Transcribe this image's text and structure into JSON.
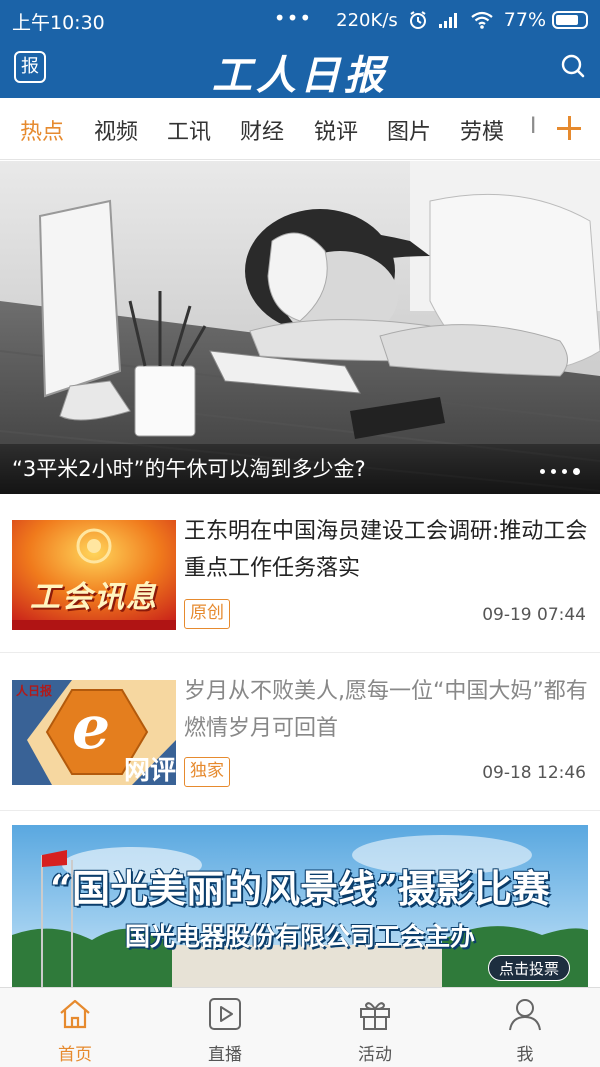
{
  "status_bar": {
    "time": "上午10:30",
    "dots": "•••",
    "speed": "220K/s",
    "battery_percent": "77%",
    "battery_level": 0.77
  },
  "header": {
    "badge": "报",
    "title": "工人日报",
    "search_icon": "search-icon"
  },
  "tabs": [
    "热点",
    "视频",
    "工讯",
    "财经",
    "锐评",
    "图片",
    "劳模"
  ],
  "tab_overflow": "I",
  "colors": {
    "brand_blue": "#1b63a8",
    "accent_orange": "#e68a2e"
  },
  "banner": {
    "caption": "“3平米2小时”的午休可以淘到多少金?",
    "slide_count": 4,
    "active_slide": 4
  },
  "articles": [
    {
      "title": "王东明在中国海员建设工会调研:推动工会重点工作任务落实",
      "tag": "原创",
      "date": "09-19 07:44",
      "thumb_text": "工会讯息"
    },
    {
      "title": "岁月从不败美人,愿每一位“中国大妈”都有燃情岁月可回首",
      "tag": "独家",
      "date": "09-18 12:46",
      "thumb_logo": "人日报",
      "thumb_letter": "e",
      "thumb_text": "网评"
    }
  ],
  "ad": {
    "title": "“国光美丽的风景线”摄影比赛",
    "subtitle": "国光电器股份有限公司工会主办",
    "vote_button": "点击投票"
  },
  "bottom_nav": [
    {
      "label": "首页",
      "icon": "home-icon"
    },
    {
      "label": "直播",
      "icon": "play-icon"
    },
    {
      "label": "活动",
      "icon": "gift-icon"
    },
    {
      "label": "我",
      "icon": "user-icon"
    }
  ]
}
